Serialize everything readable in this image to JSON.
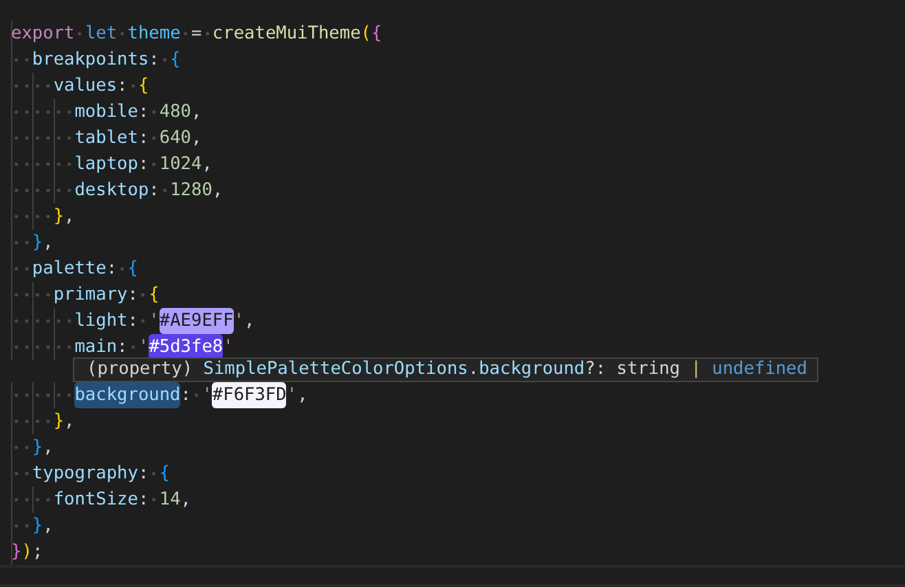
{
  "lines": [
    {
      "kind": "code",
      "tokens": [
        {
          "kind": "control",
          "text": "export"
        },
        {
          "kind": "space"
        },
        {
          "kind": "keyword",
          "text": "let"
        },
        {
          "kind": "space"
        },
        {
          "kind": "variable",
          "text": "theme"
        },
        {
          "kind": "space"
        },
        {
          "kind": "punct",
          "text": "="
        },
        {
          "kind": "space"
        },
        {
          "kind": "func",
          "text": "createMuiTheme"
        },
        {
          "kind": "bracket",
          "text": "(",
          "color": "#ffd700"
        },
        {
          "kind": "bracket",
          "text": "{",
          "color": "#da70d6"
        }
      ]
    },
    {
      "kind": "code",
      "tokens": [
        {
          "kind": "indent1"
        },
        {
          "kind": "prop",
          "text": "breakpoints"
        },
        {
          "kind": "punct",
          "text": ":"
        },
        {
          "kind": "space"
        },
        {
          "kind": "bracket",
          "text": "{",
          "color": "#179fff"
        }
      ]
    },
    {
      "kind": "code",
      "tokens": [
        {
          "kind": "indent2"
        },
        {
          "kind": "prop",
          "text": "values"
        },
        {
          "kind": "punct",
          "text": ":"
        },
        {
          "kind": "space"
        },
        {
          "kind": "bracket",
          "text": "{",
          "color": "#ffd700"
        }
      ]
    },
    {
      "kind": "code",
      "tokens": [
        {
          "kind": "indent3"
        },
        {
          "kind": "prop",
          "text": "mobile"
        },
        {
          "kind": "punct",
          "text": ":"
        },
        {
          "kind": "space"
        },
        {
          "kind": "num",
          "text": "480"
        },
        {
          "kind": "punct",
          "text": ","
        }
      ]
    },
    {
      "kind": "code",
      "tokens": [
        {
          "kind": "indent3"
        },
        {
          "kind": "prop",
          "text": "tablet"
        },
        {
          "kind": "punct",
          "text": ":"
        },
        {
          "kind": "space"
        },
        {
          "kind": "num",
          "text": "640"
        },
        {
          "kind": "punct",
          "text": ","
        }
      ]
    },
    {
      "kind": "code",
      "tokens": [
        {
          "kind": "indent3"
        },
        {
          "kind": "prop",
          "text": "laptop"
        },
        {
          "kind": "punct",
          "text": ":"
        },
        {
          "kind": "space"
        },
        {
          "kind": "num",
          "text": "1024"
        },
        {
          "kind": "punct",
          "text": ","
        }
      ]
    },
    {
      "kind": "code",
      "tokens": [
        {
          "kind": "indent3"
        },
        {
          "kind": "prop",
          "text": "desktop"
        },
        {
          "kind": "punct",
          "text": ":"
        },
        {
          "kind": "space"
        },
        {
          "kind": "num",
          "text": "1280"
        },
        {
          "kind": "punct",
          "text": ","
        }
      ]
    },
    {
      "kind": "code",
      "tokens": [
        {
          "kind": "indent2"
        },
        {
          "kind": "bracket",
          "text": "}",
          "color": "#ffd700"
        },
        {
          "kind": "punct",
          "text": ","
        }
      ]
    },
    {
      "kind": "code",
      "tokens": [
        {
          "kind": "indent1"
        },
        {
          "kind": "bracket",
          "text": "}",
          "color": "#179fff"
        },
        {
          "kind": "punct",
          "text": ","
        }
      ]
    },
    {
      "kind": "code",
      "tokens": [
        {
          "kind": "indent1"
        },
        {
          "kind": "prop",
          "text": "palette"
        },
        {
          "kind": "punct",
          "text": ":"
        },
        {
          "kind": "space"
        },
        {
          "kind": "bracket",
          "text": "{",
          "color": "#179fff"
        }
      ]
    },
    {
      "kind": "code",
      "tokens": [
        {
          "kind": "indent2"
        },
        {
          "kind": "prop",
          "text": "primary"
        },
        {
          "kind": "punct",
          "text": ":"
        },
        {
          "kind": "space"
        },
        {
          "kind": "bracket",
          "text": "{",
          "color": "#ffd700"
        }
      ]
    },
    {
      "kind": "code",
      "tokens": [
        {
          "kind": "indent3"
        },
        {
          "kind": "prop",
          "text": "light"
        },
        {
          "kind": "punct",
          "text": ":"
        },
        {
          "kind": "space"
        },
        {
          "kind": "str",
          "text": "'"
        },
        {
          "kind": "colorlit",
          "text": "#AE9EFF",
          "color": "#ae9eff"
        },
        {
          "kind": "str",
          "text": "'"
        },
        {
          "kind": "punct",
          "text": ","
        }
      ]
    },
    {
      "kind": "code",
      "tokens": [
        {
          "kind": "indent3"
        },
        {
          "kind": "prop",
          "text": "main"
        },
        {
          "kind": "punct",
          "text": ":"
        },
        {
          "kind": "space"
        },
        {
          "kind": "str",
          "text": "'"
        },
        {
          "kind": "colorlit",
          "text": "#5d3fe8",
          "color": "#5d3fe8"
        },
        {
          "kind": "str",
          "text": "'"
        }
      ]
    },
    {
      "kind": "hover",
      "tokens": [
        {
          "kind": "plain",
          "text": "(property)"
        },
        {
          "kind": "space"
        },
        {
          "kind": "prop",
          "text": "SimplePaletteColorOptions"
        },
        {
          "kind": "plain",
          "text": "."
        },
        {
          "kind": "prop",
          "text": "background"
        },
        {
          "kind": "plain",
          "text": "?:"
        },
        {
          "kind": "space"
        },
        {
          "kind": "plain",
          "text": "string"
        },
        {
          "kind": "space"
        },
        {
          "kind": "bracket",
          "text": "|",
          "color": "#d7ba7d"
        },
        {
          "kind": "space"
        },
        {
          "kind": "keyword",
          "text": "undefined"
        }
      ]
    },
    {
      "kind": "code",
      "tokens": [
        {
          "kind": "indent3"
        },
        {
          "kind": "proplit",
          "text": "background"
        },
        {
          "kind": "punct",
          "text": ":"
        },
        {
          "kind": "space"
        },
        {
          "kind": "str",
          "text": "'"
        },
        {
          "kind": "colorlit",
          "text": "#F6F3FD",
          "color": "#f6f3fd"
        },
        {
          "kind": "str",
          "text": "'"
        },
        {
          "kind": "punct",
          "text": ","
        }
      ]
    },
    {
      "kind": "code",
      "tokens": [
        {
          "kind": "indent2"
        },
        {
          "kind": "bracket",
          "text": "}",
          "color": "#ffd700"
        },
        {
          "kind": "punct",
          "text": ","
        }
      ]
    },
    {
      "kind": "code",
      "tokens": [
        {
          "kind": "indent1"
        },
        {
          "kind": "bracket",
          "text": "}",
          "color": "#179fff"
        },
        {
          "kind": "punct",
          "text": ","
        }
      ]
    },
    {
      "kind": "code",
      "tokens": [
        {
          "kind": "indent1"
        },
        {
          "kind": "prop",
          "text": "typography"
        },
        {
          "kind": "punct",
          "text": ":"
        },
        {
          "kind": "space"
        },
        {
          "kind": "bracket",
          "text": "{",
          "color": "#179fff"
        }
      ]
    },
    {
      "kind": "code",
      "tokens": [
        {
          "kind": "indent2"
        },
        {
          "kind": "prop",
          "text": "fontSize"
        },
        {
          "kind": "punct",
          "text": ":"
        },
        {
          "kind": "space"
        },
        {
          "kind": "num",
          "text": "14"
        },
        {
          "kind": "punct",
          "text": ","
        }
      ]
    },
    {
      "kind": "code",
      "tokens": [
        {
          "kind": "indent1"
        },
        {
          "kind": "bracket",
          "text": "}",
          "color": "#179fff"
        },
        {
          "kind": "punct",
          "text": ","
        }
      ]
    },
    {
      "kind": "code",
      "tokens": [
        {
          "kind": "bracket",
          "text": "}",
          "color": "#da70d6"
        },
        {
          "kind": "bracket",
          "text": ")",
          "color": "#ffd700"
        },
        {
          "kind": "punct",
          "text": ";"
        }
      ]
    }
  ]
}
